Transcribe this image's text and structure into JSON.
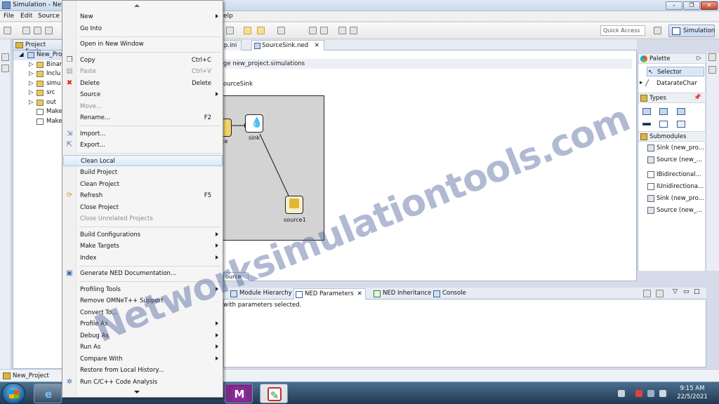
{
  "window": {
    "title": "Simulation - New"
  },
  "menubar": [
    "File",
    "Edit",
    "Source",
    "elp"
  ],
  "toolbar": {
    "quick_access_placeholder": "Quick Access",
    "perspective_label": "Simulation"
  },
  "explorer": {
    "tab_label": "Project Explo",
    "items": [
      {
        "label": "New_Pro"
      },
      {
        "label": "Binar"
      },
      {
        "label": "Inclu"
      },
      {
        "label": "simu"
      },
      {
        "label": "src"
      },
      {
        "label": "out"
      },
      {
        "label": "Make"
      },
      {
        "label": "Make"
      }
    ]
  },
  "editor": {
    "tabs": [
      "p.ini",
      "SourceSink.ned"
    ],
    "package_line": "ge new_project.simulations",
    "network_line": "ourceSink",
    "bottom_tab": "ource",
    "modules": [
      "rce",
      "sink",
      "source1"
    ]
  },
  "palette": {
    "title": "Palette",
    "items": [
      "Selector",
      "DatarateChan..."
    ],
    "types_title": "Types",
    "submodules_title": "Submodules",
    "submodules": [
      "Sink (new_pro...",
      "Source (new_...",
      "IBidirectional...",
      "IUnidirectiona...",
      "Sink (new_pro...",
      "Source (new_..."
    ]
  },
  "bottom": {
    "tabs": [
      "Module Hierarchy",
      "NED Parameters",
      "NED Inheritance",
      "Console"
    ],
    "message": "with parameters selected."
  },
  "statusbar": {
    "text": "New_Project"
  },
  "clock": {
    "time": "9:15 AM",
    "date": "22/5/2021"
  },
  "context_menu": {
    "items": [
      {
        "label": "New",
        "shortcut": "",
        "submenu": true,
        "disabled": false
      },
      {
        "label": "Go Into",
        "shortcut": "",
        "submenu": false,
        "disabled": false
      },
      {
        "label": "Open in New Window",
        "shortcut": "",
        "submenu": false,
        "disabled": false
      },
      {
        "label": "Copy",
        "shortcut": "Ctrl+C",
        "submenu": false,
        "disabled": false
      },
      {
        "label": "Paste",
        "shortcut": "Ctrl+V",
        "submenu": false,
        "disabled": true
      },
      {
        "label": "Delete",
        "shortcut": "Delete",
        "submenu": false,
        "disabled": false
      },
      {
        "label": "Source",
        "shortcut": "",
        "submenu": true,
        "disabled": false
      },
      {
        "label": "Move...",
        "shortcut": "",
        "submenu": false,
        "disabled": true
      },
      {
        "label": "Rename...",
        "shortcut": "F2",
        "submenu": false,
        "disabled": false
      },
      {
        "label": "Import...",
        "shortcut": "",
        "submenu": false,
        "disabled": false
      },
      {
        "label": "Export...",
        "shortcut": "",
        "submenu": false,
        "disabled": false
      },
      {
        "label": "Clean Local",
        "shortcut": "",
        "submenu": false,
        "disabled": false
      },
      {
        "label": "Build Project",
        "shortcut": "",
        "submenu": false,
        "disabled": false
      },
      {
        "label": "Clean Project",
        "shortcut": "",
        "submenu": false,
        "disabled": false
      },
      {
        "label": "Refresh",
        "shortcut": "F5",
        "submenu": false,
        "disabled": false
      },
      {
        "label": "Close Project",
        "shortcut": "",
        "submenu": false,
        "disabled": false
      },
      {
        "label": "Close Unrelated Projects",
        "shortcut": "",
        "submenu": false,
        "disabled": true
      },
      {
        "label": "Build Configurations",
        "shortcut": "",
        "submenu": true,
        "disabled": false
      },
      {
        "label": "Make Targets",
        "shortcut": "",
        "submenu": true,
        "disabled": false
      },
      {
        "label": "Index",
        "shortcut": "",
        "submenu": true,
        "disabled": false
      },
      {
        "label": "Generate NED Documentation...",
        "shortcut": "",
        "submenu": false,
        "disabled": false
      },
      {
        "label": "Profiling Tools",
        "shortcut": "",
        "submenu": true,
        "disabled": false
      },
      {
        "label": "Remove OMNeT++ Support",
        "shortcut": "",
        "submenu": false,
        "disabled": false
      },
      {
        "label": "Convert To...",
        "shortcut": "",
        "submenu": false,
        "disabled": false
      },
      {
        "label": "Profile As",
        "shortcut": "",
        "submenu": true,
        "disabled": false
      },
      {
        "label": "Debug As",
        "shortcut": "",
        "submenu": true,
        "disabled": false
      },
      {
        "label": "Run As",
        "shortcut": "",
        "submenu": true,
        "disabled": false
      },
      {
        "label": "Compare With",
        "shortcut": "",
        "submenu": true,
        "disabled": false
      },
      {
        "label": "Restore from Local History...",
        "shortcut": "",
        "submenu": false,
        "disabled": false
      },
      {
        "label": "Run C/C++ Code Analysis",
        "shortcut": "",
        "submenu": false,
        "disabled": false
      }
    ]
  },
  "watermark": "Networksimulationtools.com"
}
